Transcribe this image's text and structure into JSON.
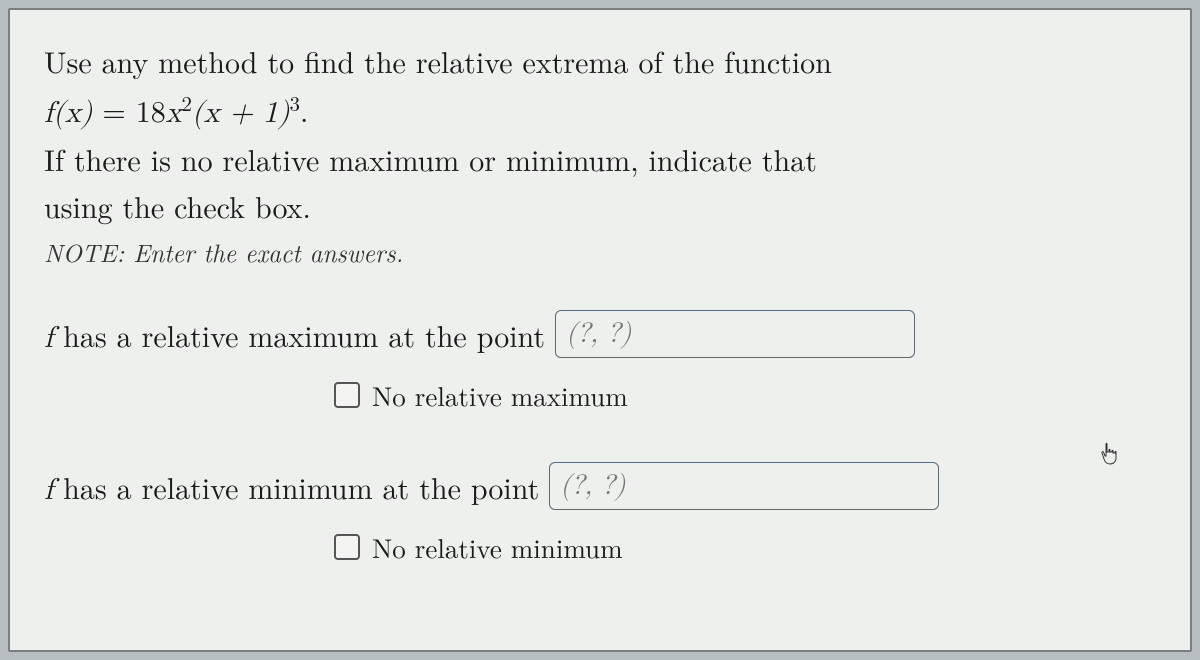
{
  "problem": {
    "line1": "Use any method to find the relative extrema of the function",
    "func_lhs": "f(x)",
    "equals": " = ",
    "coeff": "18",
    "xpart": "x",
    "exp2": "2",
    "paren": "(x + 1)",
    "exp3": "3",
    "period": ".",
    "line3": "If there is no relative maximum or minimum, indicate that",
    "line4": "using the check box.",
    "note_prefix": "NOTE:",
    "note_rest": " Enter the exact answers."
  },
  "answers": {
    "max_prefix": "f",
    "max_text": " has a relative maximum at the point ",
    "max_placeholder": "(?, ?)",
    "no_max_label": "No relative maximum",
    "min_prefix": "f",
    "min_text": " has a relative minimum at the point ",
    "min_placeholder": "(?, ?)",
    "no_min_label": "No relative minimum"
  }
}
